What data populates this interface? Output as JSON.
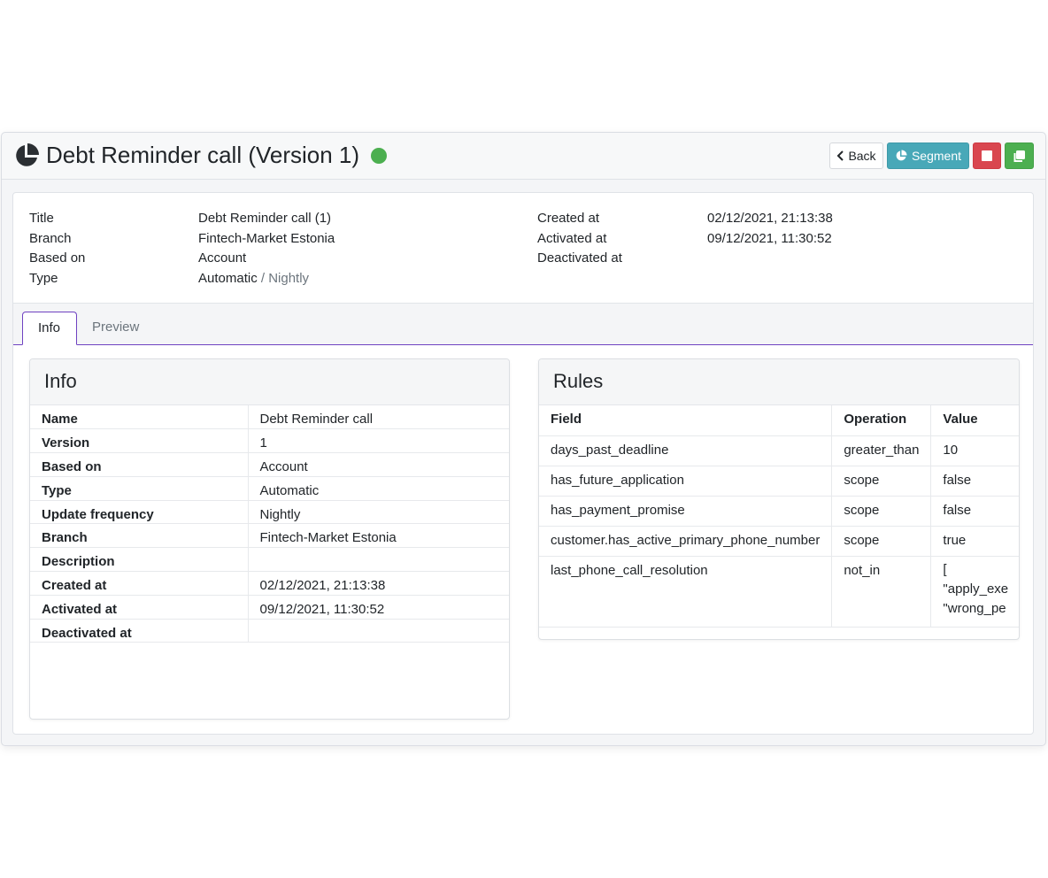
{
  "header": {
    "title": "Debt Reminder call (Version 1)",
    "status_color": "#4caf50",
    "icon": "pie-chart-icon",
    "buttons": {
      "back": "Back",
      "segment": "Segment",
      "stop_icon": "stop-icon",
      "copy_icon": "copy-icon"
    }
  },
  "summary": {
    "left": [
      {
        "label": "Title",
        "value": "Debt Reminder call (1)"
      },
      {
        "label": "Branch",
        "value": "Fintech-Market Estonia"
      },
      {
        "label": "Based on",
        "value": "Account"
      },
      {
        "label": "Type",
        "value": "Automatic",
        "suffix": "/ Nightly"
      }
    ],
    "right": [
      {
        "label": "Created at",
        "value": "02/12/2021, 21:13:38"
      },
      {
        "label": "Activated at",
        "value": "09/12/2021, 11:30:52"
      },
      {
        "label": "Deactivated at",
        "value": ""
      }
    ]
  },
  "tabs": [
    {
      "label": "Info",
      "active": true
    },
    {
      "label": "Preview",
      "active": false
    }
  ],
  "info_panel": {
    "title": "Info",
    "rows": [
      {
        "key": "Name",
        "value": "Debt Reminder call"
      },
      {
        "key": "Version",
        "value": "1"
      },
      {
        "key": "Based on",
        "value": "Account"
      },
      {
        "key": "Type",
        "value": "Automatic"
      },
      {
        "key": "Update frequency",
        "value": "Nightly"
      },
      {
        "key": "Branch",
        "value": "Fintech-Market Estonia"
      },
      {
        "key": "Description",
        "value": ""
      },
      {
        "key": "Created at",
        "value": "02/12/2021, 21:13:38"
      },
      {
        "key": "Activated at",
        "value": "09/12/2021, 11:30:52"
      },
      {
        "key": "Deactivated at",
        "value": ""
      }
    ]
  },
  "rules_panel": {
    "title": "Rules",
    "columns": [
      "Field",
      "Operation",
      "Value"
    ],
    "rows": [
      {
        "field": "days_past_deadline",
        "operation": "greater_than",
        "value": "10"
      },
      {
        "field": "has_future_application",
        "operation": "scope",
        "value": "false"
      },
      {
        "field": "has_payment_promise",
        "operation": "scope",
        "value": "false"
      },
      {
        "field": "customer.has_active_primary_phone_number",
        "operation": "scope",
        "value": "true"
      },
      {
        "field": "last_phone_call_resolution",
        "operation": "not_in",
        "value_lines": [
          "[",
          "\"apply_exe",
          "\"wrong_pe"
        ]
      }
    ]
  }
}
